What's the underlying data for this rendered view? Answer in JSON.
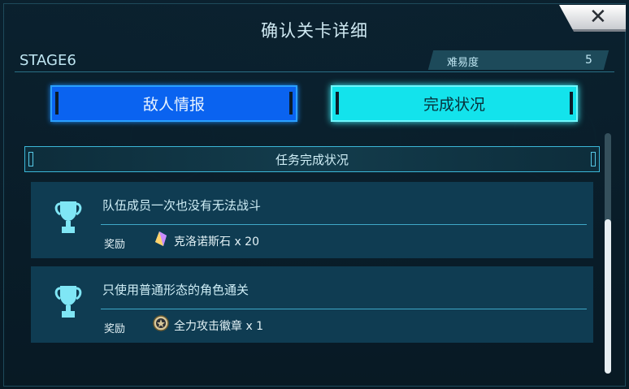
{
  "dialog": {
    "title": "确认关卡详细",
    "close_glyph": "✕",
    "stage_label": "STAGE6",
    "difficulty_label": "难易度",
    "difficulty_value": "5"
  },
  "tabs": [
    {
      "label": "敌人情报",
      "active": false
    },
    {
      "label": "完成状况",
      "active": true
    }
  ],
  "section": {
    "title": "任务完成状况"
  },
  "missions": [
    {
      "title": "队伍成员一次也没有无法战斗",
      "reward_label": "奖励",
      "reward_icon": "crystal-icon",
      "reward_text": "克洛诺斯石 x 20"
    },
    {
      "title": "只使用普通形态的角色通关",
      "reward_label": "奖励",
      "reward_icon": "medal-icon",
      "reward_text": "全力攻击徽章 x 1"
    }
  ],
  "colors": {
    "accent_cyan": "#13e3ec",
    "accent_blue": "#0a63f0",
    "panel_bg": "#0f3c52"
  }
}
